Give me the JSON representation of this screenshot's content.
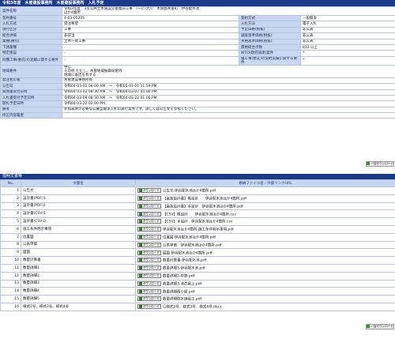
{
  "header": {
    "title": "令和3年度　木曽建設事務所　木曽建設事務所　入札予定"
  },
  "info_rows": [
    {
      "l1": "案件名称",
      "v1": "令和3年度　3災公共土木施設災害復旧工事　(一)八沢川　木曽郡木曽町　伊谷配水池\nほか4箇所",
      "l2": "",
      "v2": ""
    },
    {
      "l1": "契約番号",
      "v1": "4-03-05205",
      "l2": "契約方式",
      "v2": "一般競争"
    },
    {
      "l1": "入札方式",
      "v1": "受注希望",
      "l2": "入札方法",
      "v2": "電子入札"
    },
    {
      "l1": "施行区分",
      "v1": "工事",
      "l2": "予定価格(税抜)",
      "v2": "非公表"
    },
    {
      "l1": "総合評価",
      "v1": "非該当",
      "l2": "調査基準価格(税抜)",
      "v2": "非公表"
    },
    {
      "l1": "業種(種別)",
      "v1": "土木一式工事",
      "l2": "失格基準価格(税抜)",
      "v2": "非公表"
    },
    {
      "l1": "下請業種",
      "v1": "-",
      "l2": "資格総合点数",
      "v2": "812 以上"
    },
    {
      "l1": "特定建設",
      "v1": "-",
      "l2": "WTO(政府調達)案件",
      "v2": "*"
    },
    {
      "l1": "同種工事(委託)の実績に関する要件",
      "v1": "-",
      "l2": "優工事(委託)の契約実績に関する要件",
      "v2": "*"
    },
    {
      "l1": "地域要件",
      "v1": "中信\nその他 ただし、木曽地域振興局管内\n地域に本店を有する",
      "l2": "",
      "v2": ""
    },
    {
      "l1": "発注者の長",
      "v1": "木曽建設事務所長",
      "l2": "",
      "v2": ""
    },
    {
      "l1": "公告日",
      "v1": "令和04-03-02 08:00 AM　〜　令和05-03-01 11:59 PM",
      "l2": "",
      "v2": ""
    },
    {
      "l1": "質問書受付日時",
      "v1": "令和04-03-02 08:30 AM　〜　令和04-03-07 05:00 PM",
      "l2": "",
      "v2": ""
    },
    {
      "l1": "入札書受付予定日時",
      "v1": "令和04-03-09 08:30 AM　〜　令和04-03-22 01:00 PM",
      "l2": "",
      "v2": ""
    },
    {
      "l1": "開札予定日時",
      "v1": "令和04-03-22 02:00 PM",
      "l2": "",
      "v2": ""
    },
    {
      "l1": "備考",
      "v1": "参加表明が必要な公募型競争入札の試行案件です。詳しくは公告文を参照ください。",
      "l2": "",
      "v2": ""
    },
    {
      "l1": "修正内容履歴",
      "v1": "",
      "l2": "",
      "v2": ""
    }
  ],
  "bulk_download_label": "一括ダウンロード",
  "docs_section": {
    "title": "指明文書等"
  },
  "docs_headers": {
    "no": "No.",
    "name": "文書名",
    "file": "格納ファイル名／外部リンクURL"
  },
  "download_label": "ダウンロード",
  "docs": [
    {
      "no": "1",
      "name": "公告文",
      "file": "公告文-伊谷配水池ほか4箇所.pdf"
    },
    {
      "no": "2",
      "name": "設計書(PDF)1",
      "file": "【金抜設計書】概設計　　伊谷配水池ほか4箇所.pdf"
    },
    {
      "no": "3",
      "name": "設計書(PDF)2",
      "file": "【金抜設計書】手設計　伊谷配水池ほか4箇所.pdf"
    },
    {
      "no": "4",
      "name": "設計書(CSV)1",
      "file": "【CSV】概設計　　伊谷配水池ほか4箇所.csv"
    },
    {
      "no": "5",
      "name": "設計書(CSV)2",
      "file": "【CSV】手設計　伊谷配水池ほか4箇所.csv"
    },
    {
      "no": "6",
      "name": "施工条件明示事項",
      "file": "伊谷配水池ほか4箇所-施工条件明示事項.pdf"
    },
    {
      "no": "7",
      "name": "位置図",
      "file": "位置図 伊谷配水池ほか4箇所.pdf"
    },
    {
      "no": "8",
      "name": "公表単価",
      "file": "公表単価　伊谷配水池ほか4箇所.pdf"
    },
    {
      "no": "9",
      "name": "図面",
      "file": "図面 伊谷配水池ほか4箇所.pdf"
    },
    {
      "no": "10",
      "name": "数量計算書",
      "file": "数量計算書-伊谷配水池.pdf"
    },
    {
      "no": "11",
      "name": "数量詳細1",
      "file": "数量詳細1-伊谷配水池.pdf"
    },
    {
      "no": "12",
      "name": "数量詳細2",
      "file": "数量詳細2-中野.pdf"
    },
    {
      "no": "13",
      "name": "数量詳細3",
      "file": "数量詳細3-池の尾上.pdf"
    },
    {
      "no": "14",
      "name": "数量詳細4",
      "file": "数量詳細西小屋.pdf"
    },
    {
      "no": "15",
      "name": "数量詳細5",
      "file": "数量詳細取水施設工.pdf"
    },
    {
      "no": "16",
      "name": "様式2号、様式3号、様式4号",
      "file": "〇様式2号、様式3号、様式4号.docx"
    }
  ]
}
